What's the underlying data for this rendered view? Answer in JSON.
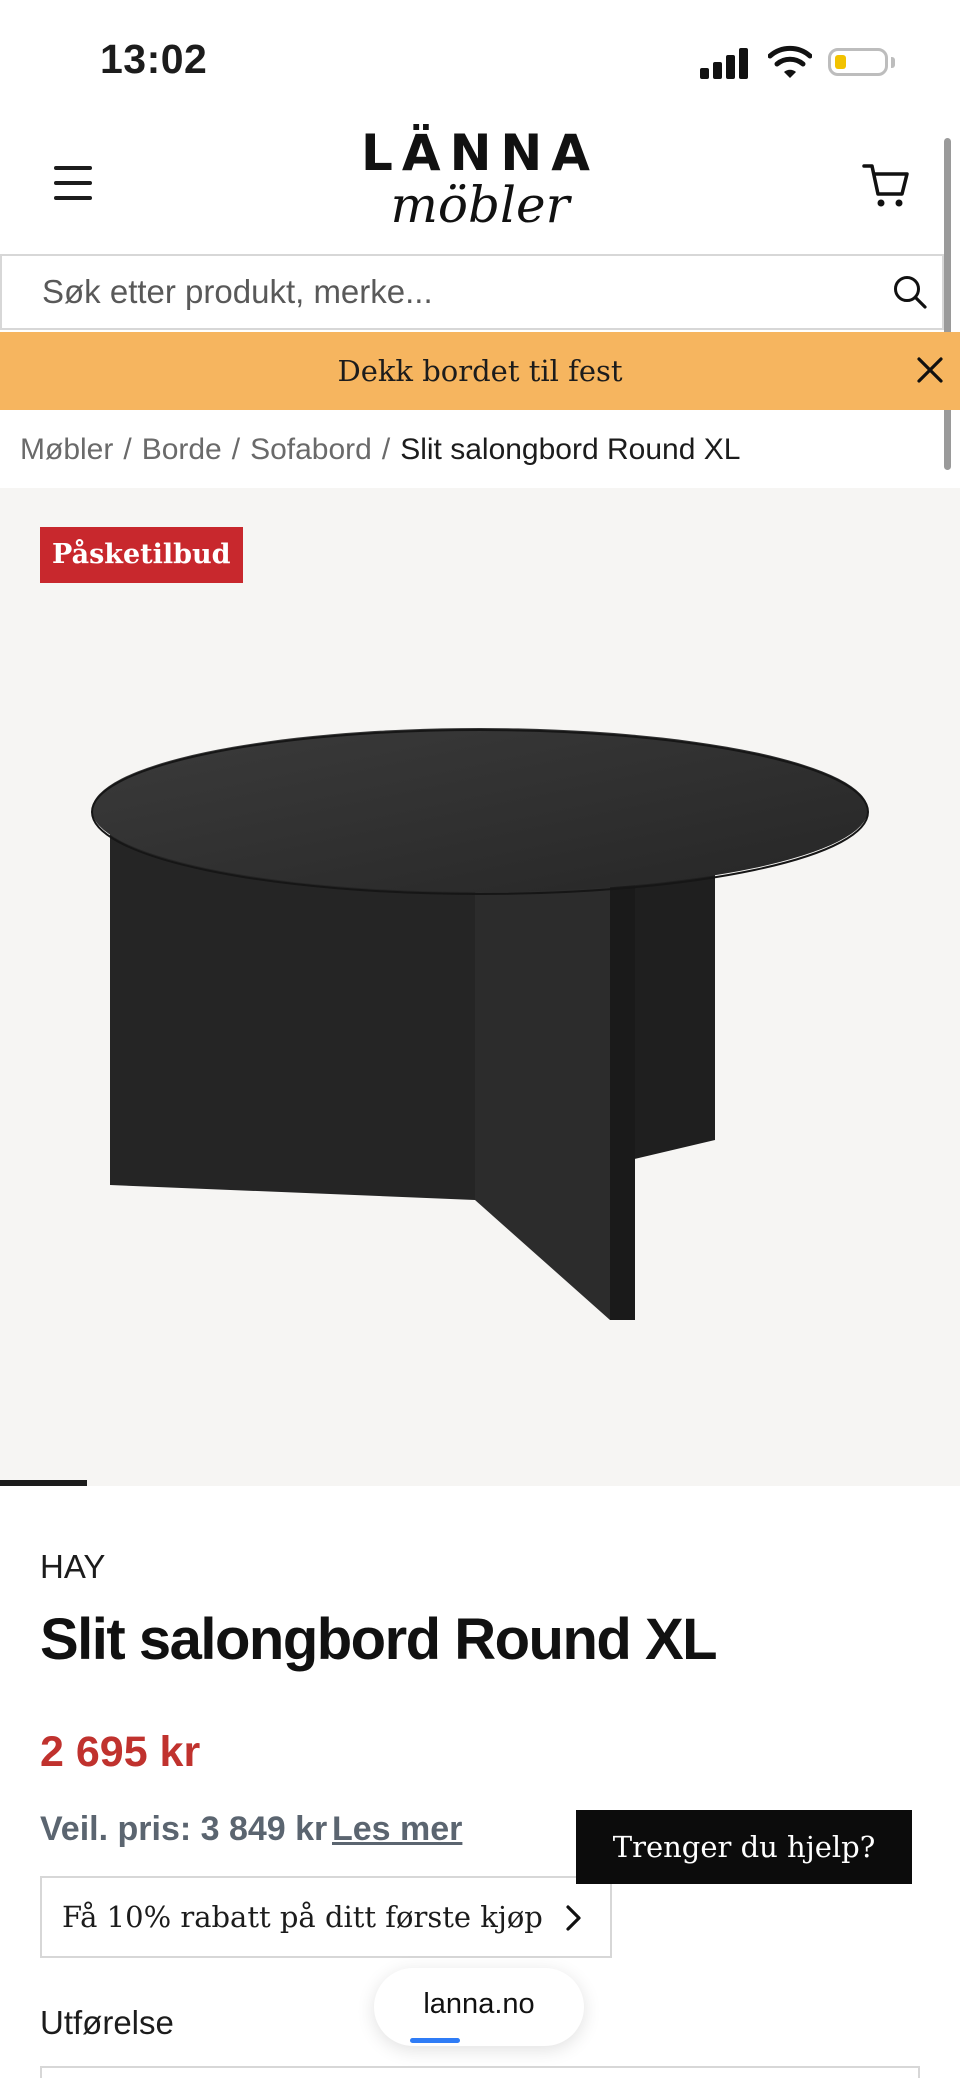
{
  "status_bar": {
    "time": "13:02",
    "battery_level": 0.2
  },
  "header": {
    "logo_line1": "LÄNNA",
    "logo_line2": "möbler",
    "menu_icon": "hamburger-menu-icon",
    "cart_icon": "shopping-cart-icon"
  },
  "search": {
    "placeholder": "Søk etter produkt, merke...",
    "value": "",
    "icon": "search-icon"
  },
  "banner": {
    "text": "Dekk bordet til fest",
    "color": "#f6b55f",
    "close_icon": "close-icon"
  },
  "breadcrumb": {
    "items": [
      "Møbler",
      "Borde",
      "Sofabord"
    ],
    "separator": "/",
    "current": "Slit salongbord Round XL"
  },
  "gallery": {
    "badge": "Påsketilbud",
    "badge_color": "#c8282d"
  },
  "product": {
    "brand": "HAY",
    "title": "Slit salongbord Round XL",
    "price": "2 695 kr",
    "price_color": "#c0322e",
    "recommended_price": "Veil. pris: 3 849 kr",
    "read_more": "Les mer",
    "discount_offer": "Få 10% rabatt på ditt første kjøp",
    "variant_label": "Utførelse"
  },
  "help_button": {
    "label": "Trenger du hjelp?"
  },
  "browser": {
    "url": "lanna.no"
  }
}
